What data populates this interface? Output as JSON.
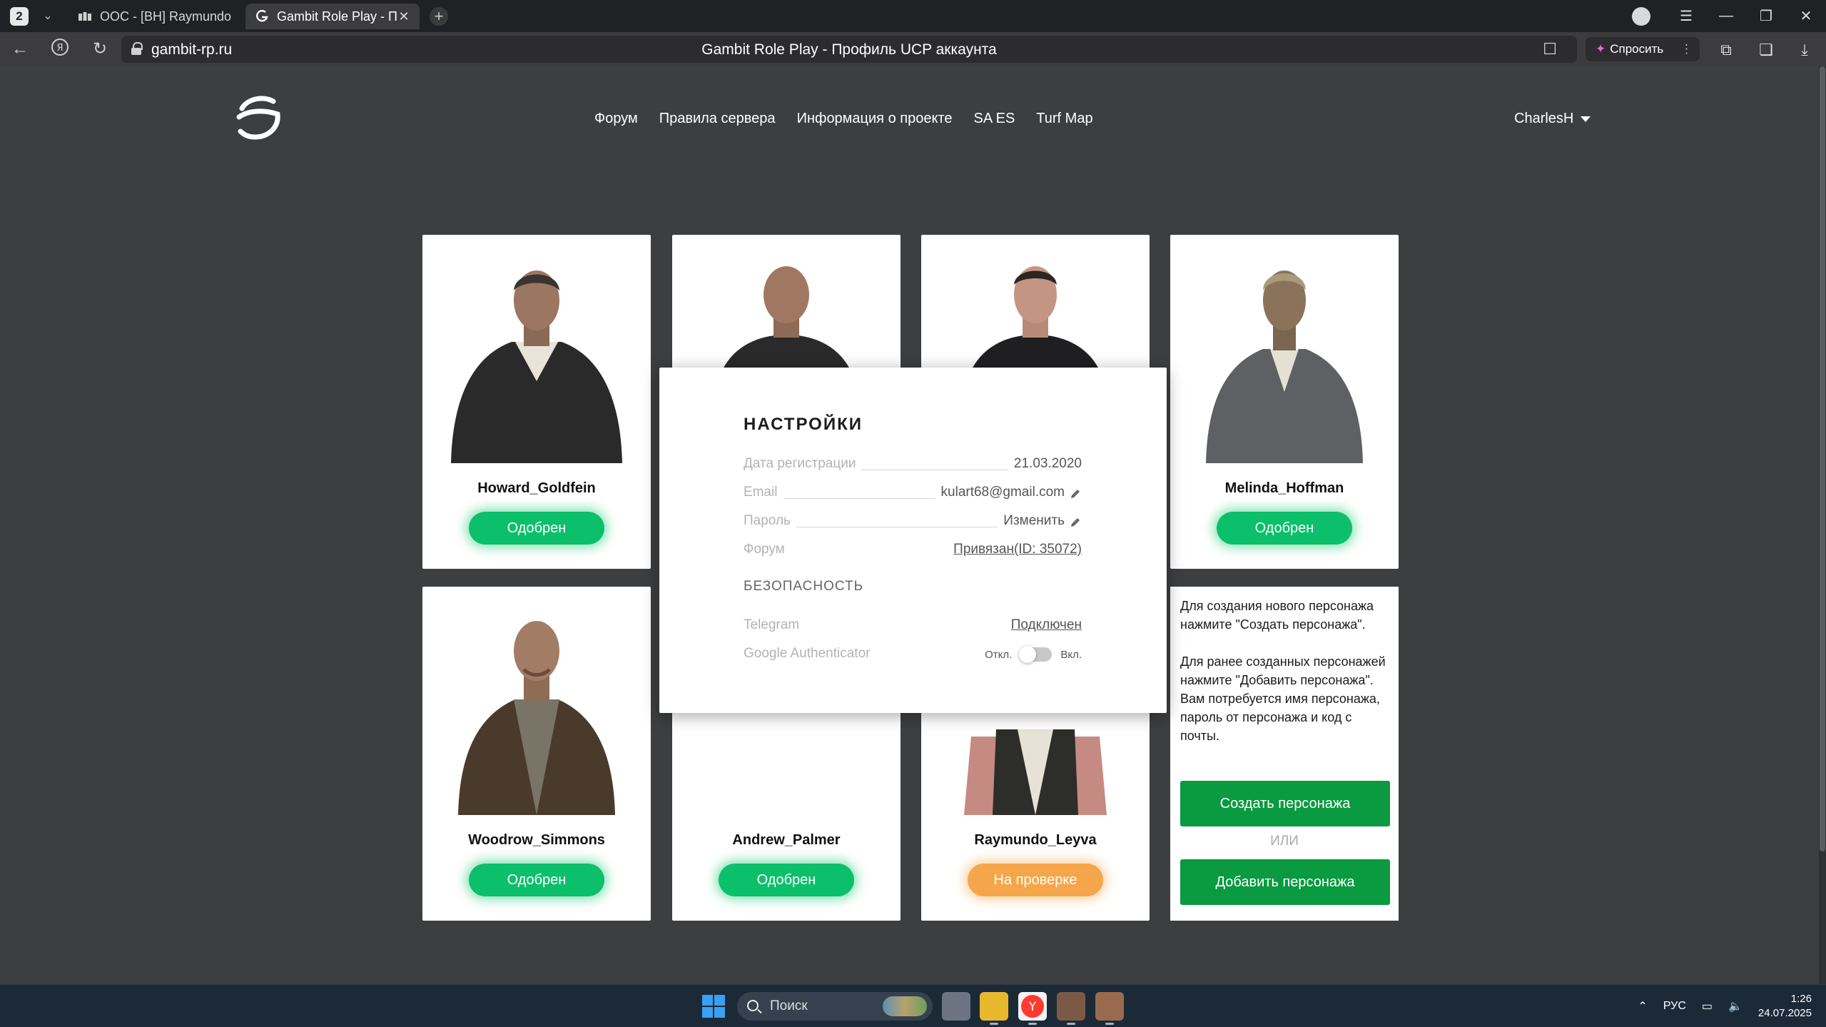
{
  "browser": {
    "tab_counter": "2",
    "tabs": [
      {
        "title": "OOC - [BH] Raymundo Leyva",
        "active": false
      },
      {
        "title": "Gambit Role Play - Профиль UCP аккаунта",
        "active": true
      }
    ],
    "address": "gambit-rp.ru",
    "page_title": "Gambit Role Play - Профиль UCP аккаунта",
    "ask_label": "Спросить"
  },
  "site": {
    "nav": [
      "Форум",
      "Правила сервера",
      "Информация о проекте",
      "SA ES",
      "Turf Map"
    ],
    "username": "CharlesH"
  },
  "characters": [
    {
      "name": "Howard_Goldfein",
      "status": "Одобрен",
      "state": "approved"
    },
    {
      "name": "",
      "status": "",
      "state": "hidden"
    },
    {
      "name": "",
      "status": "",
      "state": "hidden"
    },
    {
      "name": "Melinda_Hoffman",
      "status": "Одобрен",
      "state": "approved"
    },
    {
      "name": "Woodrow_Simmons",
      "status": "Одобрен",
      "state": "approved"
    },
    {
      "name": "Andrew_Palmer",
      "status": "Одобрен",
      "state": "approved"
    },
    {
      "name": "Raymundo_Leyva",
      "status": "На проверке",
      "state": "pending"
    }
  ],
  "info": {
    "text_1": "Для создания нового персонажа нажмите \"Создать персонажа\".",
    "text_2": "Для ранее созданных персонажей нажмите \"Добавить персонажа\". Вам потребуется имя персонажа, пароль от персонажа и код с почты.",
    "create_label": "Создать персонажа",
    "or_label": "ИЛИ",
    "add_label": "Добавить персонажа"
  },
  "settings": {
    "title": "НАСТРОЙКИ",
    "reg_label": "Дата регистрации",
    "reg_value": "21.03.2020",
    "email_label": "Email",
    "email_value": "kulart68@gmail.com",
    "password_label": "Пароль",
    "password_value": "Изменить",
    "forum_label": "Форум",
    "forum_value": "Привязан(ID: 35072)",
    "security_title": "БЕЗОПАСНОСТЬ",
    "telegram_label": "Telegram",
    "telegram_value": "Подключен",
    "ga_label": "Google Authenticator",
    "ga_off": "Откл.",
    "ga_on": "Вкл.",
    "ga_enabled": false
  },
  "taskbar": {
    "search_placeholder": "Поиск",
    "lang": "РУС",
    "time": "1:26",
    "date": "24.07.2025"
  }
}
